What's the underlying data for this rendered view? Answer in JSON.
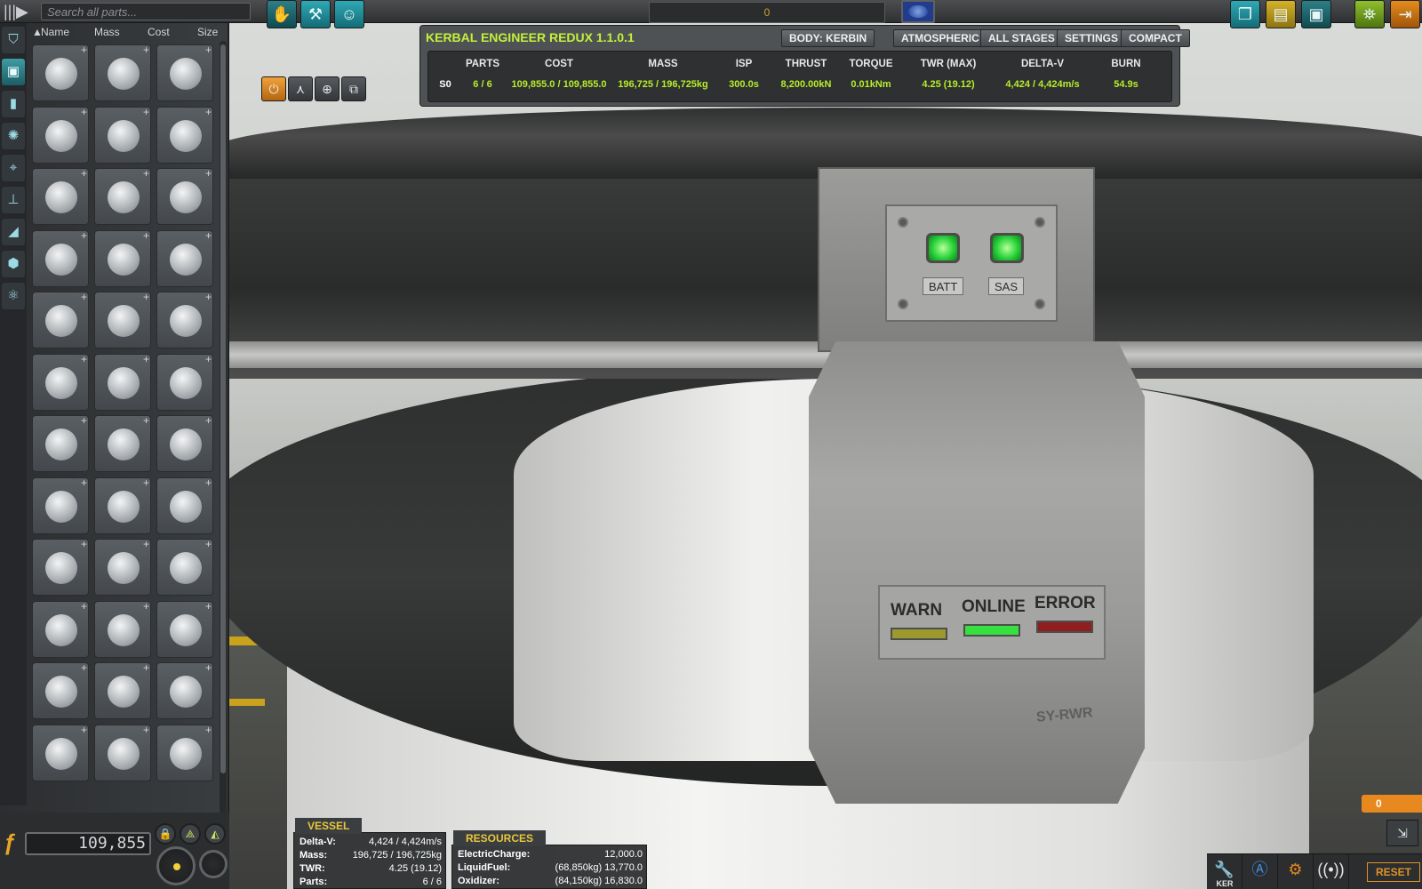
{
  "topbar": {
    "search_placeholder": "Search all parts...",
    "vessel_name": "0",
    "left_tools": [
      "place-icon",
      "hammer-wrench-icon",
      "crew-icon"
    ],
    "right_tools": [
      "new-icon",
      "load-icon",
      "save-icon",
      "launchpad-icon",
      "exit-icon"
    ]
  },
  "parts": {
    "sort_columns": [
      "Name",
      "Mass",
      "Cost",
      "Size"
    ],
    "sort_arrow": "▲",
    "categories": [
      "pods",
      "fuel",
      "engines",
      "control",
      "structural",
      "aero",
      "utility",
      "science"
    ],
    "funds": "109,855",
    "rows": 12
  },
  "ker": {
    "title": "KERBAL ENGINEER REDUX 1.1.0.1",
    "buttons": [
      "BODY: KERBIN",
      "ATMOSPHERIC",
      "ALL STAGES",
      "SETTINGS",
      "COMPACT"
    ],
    "headers": [
      "PARTS",
      "COST",
      "MASS",
      "ISP",
      "THRUST",
      "TORQUE",
      "TWR (MAX)",
      "DELTA-V",
      "BURN"
    ],
    "stage_label": "S0",
    "row": [
      "6 / 6",
      "109,855.0 / 109,855.0",
      "196,725 / 196,725kg",
      "300.0s",
      "8,200.00kN",
      "0.01kNm",
      "4.25 (19.12)",
      "4,424 / 4,424m/s",
      "54.9s"
    ]
  },
  "vessel": {
    "tab": "VESSEL",
    "rows": [
      {
        "label": "Delta-V:",
        "value": "4,424 / 4,424m/s"
      },
      {
        "label": "Mass:",
        "value": "196,725 / 196,725kg"
      },
      {
        "label": "TWR:",
        "value": "4.25 (19.12)"
      },
      {
        "label": "Parts:",
        "value": "6 / 6"
      }
    ]
  },
  "resources": {
    "tab": "RESOURCES",
    "rows": [
      {
        "label": "ElectricCharge:",
        "value": "12,000.0"
      },
      {
        "label": "LiquidFuel:",
        "value": "(68,850kg) 13,770.0"
      },
      {
        "label": "Oxidizer:",
        "value": "(84,150kg) 16,830.0"
      }
    ]
  },
  "model": {
    "batt": "BATT",
    "sas": "SAS",
    "warn": "WARN",
    "online": "ONLINE",
    "error": "ERROR",
    "code": "SY-RWR"
  },
  "bottom_right": {
    "ker_label": "KER",
    "reset": "RESET",
    "counter": "0",
    "colors": {
      "accent": "#e7891f",
      "ker_green": "#b9ee2a",
      "title_green": "#c4f03a"
    }
  }
}
